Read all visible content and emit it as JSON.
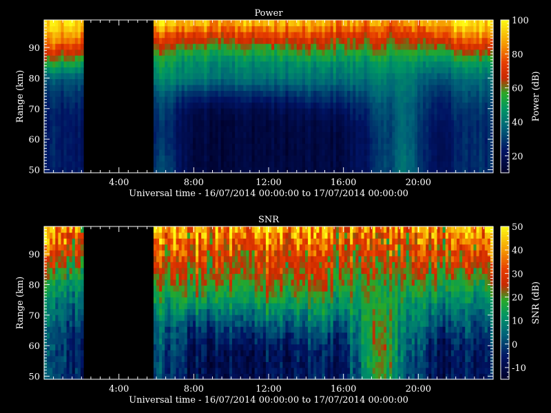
{
  "colors": {
    "background": "#000000",
    "frame": "#ffffff",
    "text": "#ffffff"
  },
  "chart_data": [
    {
      "type": "heatmap",
      "title": "Power",
      "xlabel": "Universal time - 16/07/2014 00:00:00 to 17/07/2014 00:00:00",
      "ylabel": "Range (km)",
      "xticks": [
        "4:00",
        "8:00",
        "12:00",
        "16:00",
        "20:00"
      ],
      "xtick_hours": [
        4,
        8,
        12,
        16,
        20
      ],
      "xlim_hours": [
        0,
        24
      ],
      "yticks": [
        50,
        60,
        70,
        80,
        90
      ],
      "ylim": [
        49,
        99
      ],
      "colorbar": {
        "label": "Power (dB)",
        "ticks": [
          20,
          40,
          60,
          80,
          100
        ],
        "range": [
          10,
          100
        ]
      },
      "data_gap_hours": [
        2.1,
        5.85
      ],
      "column_hours": [
        0.35,
        1.3,
        6.5,
        8.0,
        10.0,
        12.0,
        14.0,
        16.0,
        18.0,
        19.2,
        21.0,
        23.0
      ],
      "row_km": [
        50,
        55,
        60,
        65,
        70,
        75,
        80,
        85,
        90,
        95,
        98
      ],
      "values": [
        [
          25,
          25,
          25,
          25,
          25,
          28,
          35,
          55,
          75,
          90,
          95
        ],
        [
          22,
          22,
          22,
          22,
          24,
          28,
          34,
          52,
          72,
          88,
          95
        ],
        [
          32,
          30,
          28,
          28,
          30,
          35,
          45,
          50,
          62,
          80,
          92
        ],
        [
          15,
          15,
          15,
          16,
          18,
          28,
          42,
          46,
          58,
          78,
          90
        ],
        [
          15,
          15,
          15,
          15,
          18,
          28,
          40,
          45,
          58,
          76,
          88
        ],
        [
          16,
          15,
          15,
          15,
          18,
          28,
          40,
          45,
          58,
          76,
          90
        ],
        [
          15,
          15,
          15,
          16,
          20,
          30,
          40,
          46,
          60,
          78,
          88
        ],
        [
          16,
          16,
          16,
          17,
          22,
          30,
          40,
          46,
          58,
          74,
          85
        ],
        [
          28,
          28,
          28,
          30,
          32,
          36,
          42,
          48,
          60,
          74,
          84
        ],
        [
          40,
          40,
          38,
          38,
          38,
          40,
          42,
          48,
          58,
          70,
          82
        ],
        [
          20,
          20,
          20,
          22,
          24,
          28,
          34,
          44,
          60,
          80,
          92
        ],
        [
          28,
          28,
          28,
          28,
          30,
          34,
          40,
          50,
          70,
          88,
          96
        ]
      ]
    },
    {
      "type": "heatmap",
      "title": "SNR",
      "xlabel": "Universal time - 16/07/2014 00:00:00 to 17/07/2014 00:00:00",
      "ylabel": "Range (km)",
      "xticks": [
        "4:00",
        "8:00",
        "12:00",
        "16:00",
        "20:00"
      ],
      "xtick_hours": [
        4,
        8,
        12,
        16,
        20
      ],
      "xlim_hours": [
        0,
        24
      ],
      "yticks": [
        50,
        60,
        70,
        80,
        90
      ],
      "ylim": [
        49,
        99
      ],
      "colorbar": {
        "label": "SNR (dB)",
        "ticks": [
          -10,
          0,
          10,
          20,
          30,
          40,
          50
        ],
        "range": [
          -15,
          50
        ]
      },
      "data_gap_hours": [
        2.1,
        5.85
      ],
      "column_hours": [
        0.35,
        1.3,
        6.5,
        8.0,
        10.0,
        12.0,
        14.0,
        16.0,
        18.0,
        19.2,
        21.0,
        23.0
      ],
      "row_km": [
        50,
        55,
        60,
        65,
        70,
        75,
        80,
        85,
        90,
        95,
        98
      ],
      "values": [
        [
          0,
          0,
          0,
          2,
          5,
          8,
          12,
          20,
          28,
          35,
          38
        ],
        [
          -2,
          -2,
          -2,
          0,
          4,
          8,
          12,
          20,
          28,
          35,
          38
        ],
        [
          0,
          0,
          2,
          4,
          8,
          14,
          20,
          24,
          30,
          36,
          40
        ],
        [
          -8,
          -8,
          -6,
          -2,
          6,
          16,
          22,
          26,
          30,
          38,
          42
        ],
        [
          -8,
          -8,
          -6,
          0,
          6,
          14,
          20,
          26,
          30,
          38,
          42
        ],
        [
          -8,
          -8,
          -6,
          0,
          8,
          16,
          22,
          26,
          30,
          38,
          44
        ],
        [
          -6,
          -6,
          -4,
          2,
          8,
          16,
          22,
          26,
          30,
          38,
          42
        ],
        [
          -6,
          -6,
          -4,
          2,
          8,
          14,
          20,
          24,
          28,
          34,
          40
        ],
        [
          22,
          24,
          24,
          22,
          20,
          18,
          18,
          22,
          26,
          32,
          36
        ],
        [
          5,
          5,
          6,
          8,
          10,
          14,
          18,
          22,
          26,
          30,
          34
        ],
        [
          -8,
          -8,
          -6,
          -2,
          4,
          10,
          16,
          22,
          28,
          34,
          38
        ],
        [
          -6,
          -6,
          -4,
          0,
          4,
          10,
          16,
          24,
          30,
          36,
          40
        ]
      ]
    }
  ]
}
